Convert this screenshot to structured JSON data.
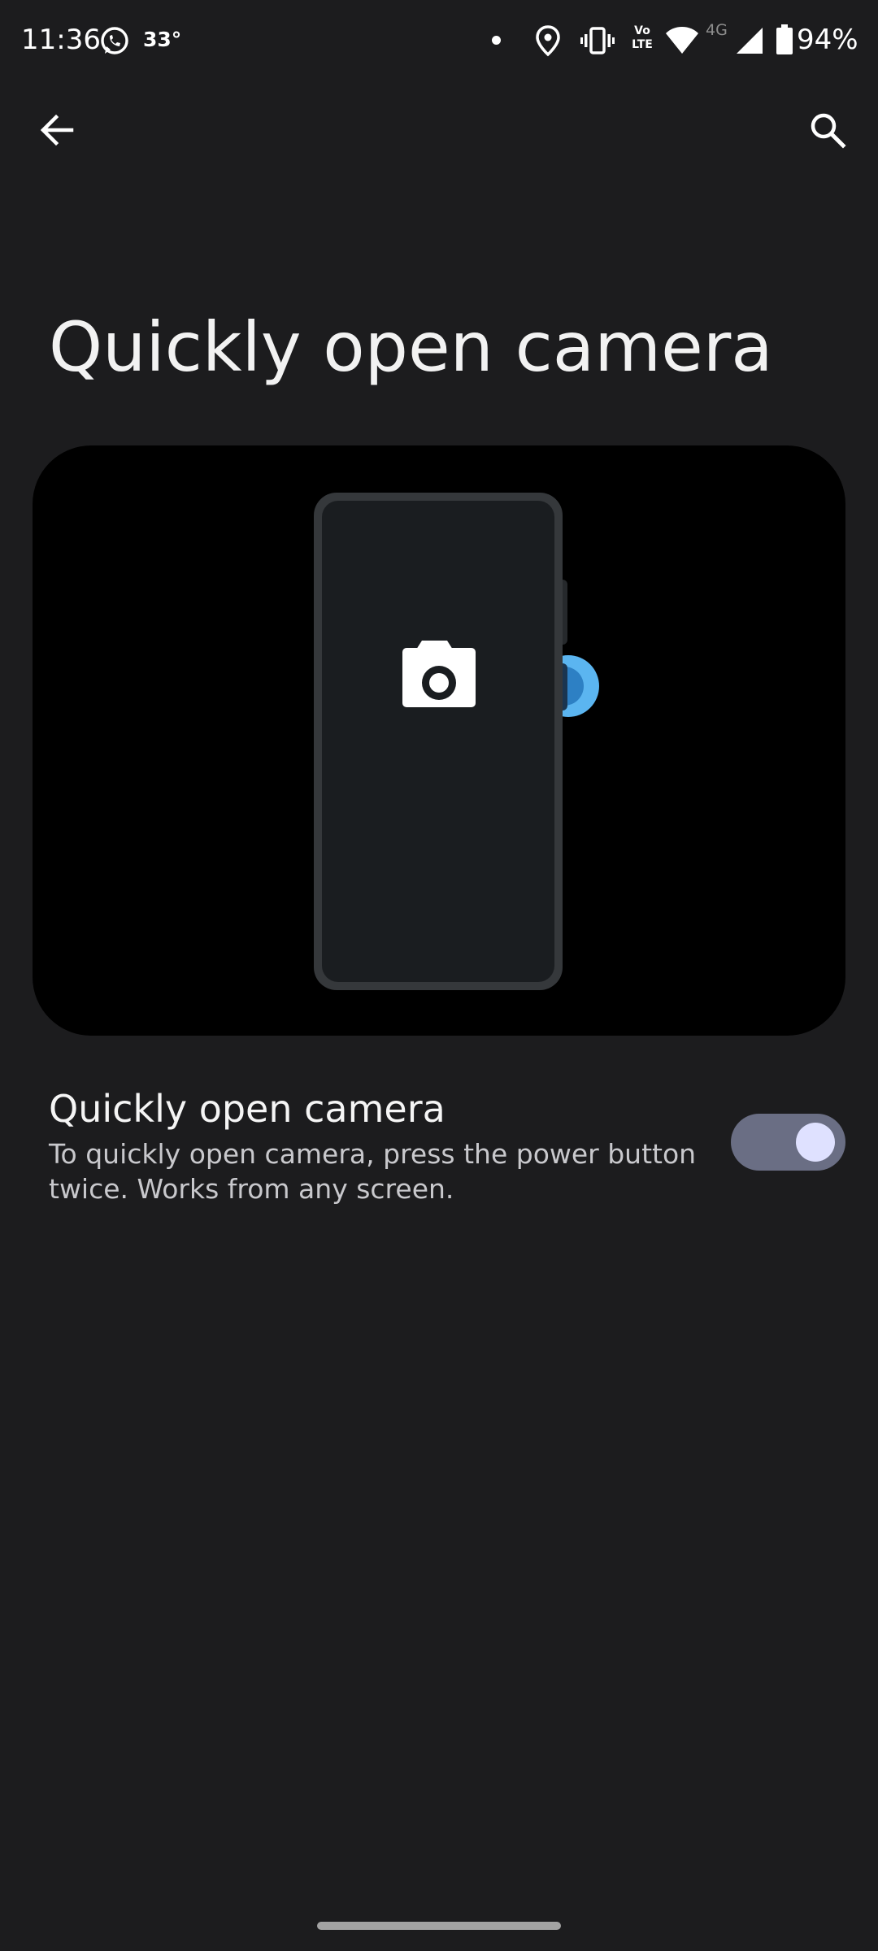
{
  "status_bar": {
    "time": "11:36",
    "temperature": "33°",
    "volte_line1": "Vo",
    "volte_line2": "LTE",
    "network": "4G",
    "battery": "94%",
    "icons": [
      "whatsapp-icon",
      "notification-dot",
      "location-icon",
      "vibrate-icon",
      "volte-icon",
      "wifi-icon",
      "signal-icon",
      "battery-icon"
    ]
  },
  "app_bar": {
    "back_icon": "arrow-back-icon",
    "search_icon": "search-icon"
  },
  "page": {
    "title": "Quickly open camera"
  },
  "illustration": {
    "icon": "camera-icon",
    "accent_color": "#5bb5f0"
  },
  "setting": {
    "title": "Quickly open camera",
    "summary": "To quickly open camera, press the power button twice. Works from any screen.",
    "enabled": true
  },
  "colors": {
    "background": "#1c1c1e",
    "toggle_track": "#6a6e84",
    "toggle_thumb": "#dfe1ff"
  }
}
